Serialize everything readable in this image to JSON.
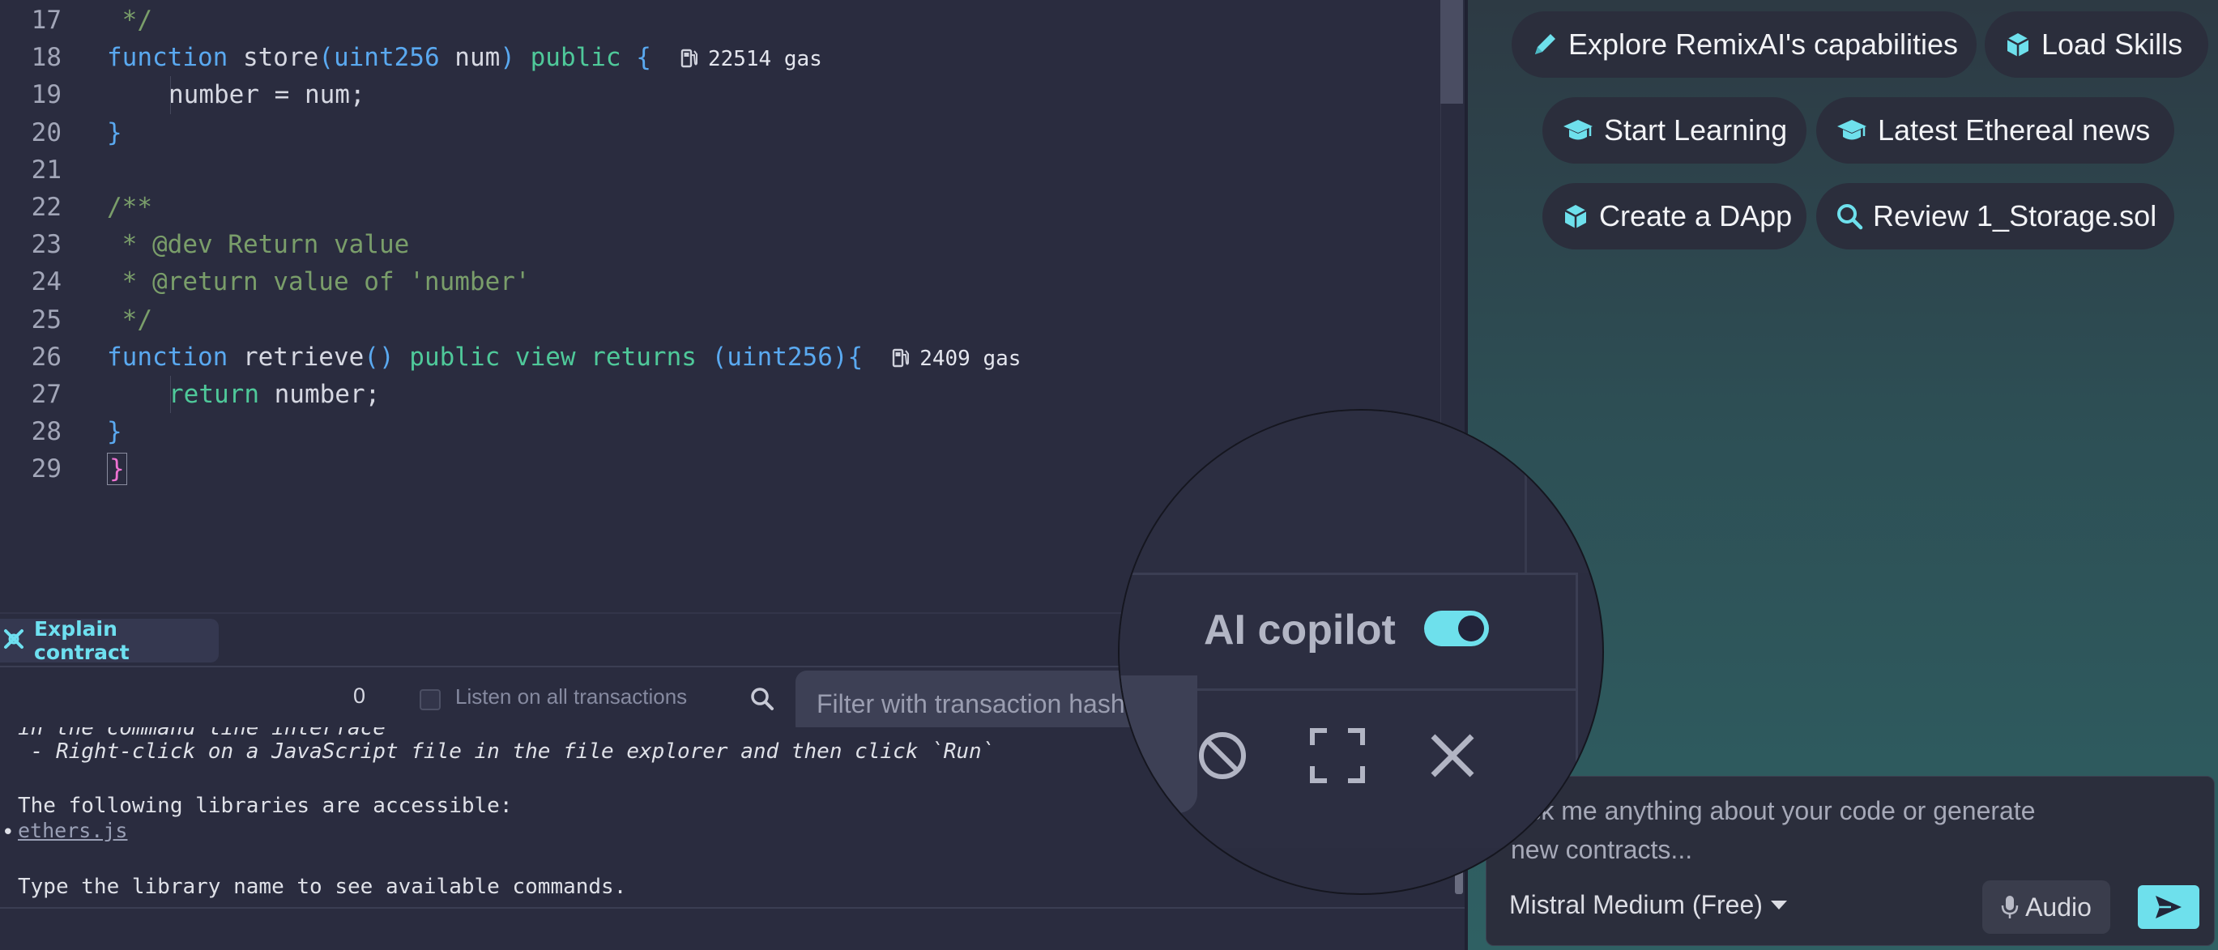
{
  "editor": {
    "lines": [
      {
        "n": "17",
        "indent": 1,
        "parts": [
          {
            "t": " */",
            "c": "cmt"
          }
        ]
      },
      {
        "n": "18",
        "indent": 1,
        "parts": [
          {
            "t": "function",
            "c": "kw"
          },
          {
            "t": " store",
            "c": ""
          },
          {
            "t": "(",
            "c": "kw"
          },
          {
            "t": "uint256",
            "c": "kw"
          },
          {
            "t": " num",
            "c": ""
          },
          {
            "t": ")",
            "c": "kw"
          },
          {
            "t": " public",
            "c": "grn"
          },
          {
            "t": " {",
            "c": "kw"
          }
        ],
        "gas": "22514 gas"
      },
      {
        "n": "19",
        "indent": 2,
        "parts": [
          {
            "t": "number = num;",
            "c": ""
          }
        ]
      },
      {
        "n": "20",
        "indent": 1,
        "parts": [
          {
            "t": "}",
            "c": "kw"
          }
        ]
      },
      {
        "n": "21",
        "indent": 0,
        "parts": []
      },
      {
        "n": "22",
        "indent": 1,
        "parts": [
          {
            "t": "/**",
            "c": "cmt"
          }
        ]
      },
      {
        "n": "23",
        "indent": 1,
        "parts": [
          {
            "t": " * @dev Return value",
            "c": "cmt"
          }
        ]
      },
      {
        "n": "24",
        "indent": 1,
        "parts": [
          {
            "t": " * @return value of 'number'",
            "c": "cmt"
          }
        ]
      },
      {
        "n": "25",
        "indent": 1,
        "parts": [
          {
            "t": " */",
            "c": "cmt"
          }
        ]
      },
      {
        "n": "26",
        "indent": 1,
        "parts": [
          {
            "t": "function",
            "c": "kw"
          },
          {
            "t": " retrieve",
            "c": ""
          },
          {
            "t": "()",
            "c": "kw"
          },
          {
            "t": " public view returns",
            "c": "grn"
          },
          {
            "t": " (",
            "c": "kw"
          },
          {
            "t": "uint256",
            "c": "kw"
          },
          {
            "t": "){",
            "c": "kw"
          }
        ],
        "gas": "2409 gas"
      },
      {
        "n": "27",
        "indent": 2,
        "parts": [
          {
            "t": "return",
            "c": "grn"
          },
          {
            "t": " number;",
            "c": ""
          }
        ]
      },
      {
        "n": "28",
        "indent": 1,
        "parts": [
          {
            "t": "}",
            "c": "kw"
          }
        ]
      },
      {
        "n": "29",
        "indent": 0,
        "parts": [
          {
            "t": "}",
            "c": "brk",
            "box": true
          }
        ]
      }
    ]
  },
  "explain": {
    "label": "Explain contract",
    "icon": "remix-ai-icon"
  },
  "terminal": {
    "tx_count": "0",
    "listen_label": "Listen on all transactions",
    "listen_checked": false,
    "filter_placeholder": "Filter with transaction hash or address",
    "lines": {
      "partial": "in the command line interface",
      "run_hint": " - Right-click on a JavaScript file in the file explorer and then click `Run`",
      "libraries": "The following libraries are accessible:",
      "bullet": "•",
      "lib_link": "ethers.js",
      "type_hint": "Type the library name to see available commands."
    }
  },
  "ai_panel": {
    "chips": [
      {
        "label": "Explore RemixAI's capabilities",
        "icon": "pencil-icon"
      },
      {
        "label": "Load Skills",
        "icon": "cube-icon"
      },
      {
        "label": "Start Learning",
        "icon": "graduation-cap-icon"
      },
      {
        "label": "Latest Ethereal news",
        "icon": "graduation-cap-icon"
      },
      {
        "label": "Create a DApp",
        "icon": "cube-icon"
      },
      {
        "label": "Review 1_Storage.sol",
        "icon": "search-icon"
      }
    ],
    "chat_placeholder": "Ask me anything about your code or generate new contracts...",
    "model": "Mistral Medium (Free)",
    "audio_label": "Audio"
  },
  "magnifier": {
    "label": "AI copilot",
    "toggle_on": true
  },
  "colors": {
    "accent": "#6ee0ec",
    "bg": "#2a2c3f",
    "chip": "#2b2e3c"
  }
}
